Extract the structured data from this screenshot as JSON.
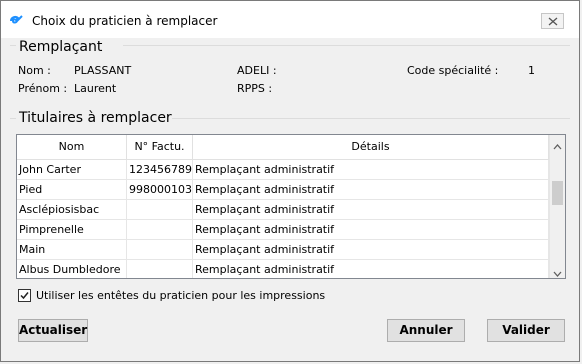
{
  "window": {
    "title": "Choix du praticien à remplacer"
  },
  "remplacant": {
    "group_title": "Remplaçant",
    "nom_label": "Nom :",
    "nom_value": "PLASSANT",
    "prenom_label": "Prénom :",
    "prenom_value": "Laurent",
    "adeli_label": "ADELI :",
    "adeli_value": "",
    "rpps_label": "RPPS :",
    "rpps_value": "",
    "code_label": "Code spécialité :",
    "code_value": "1"
  },
  "titulaires": {
    "group_title": "Titulaires à remplacer",
    "columns": [
      "Nom",
      "N° Factu.",
      "Détails"
    ],
    "rows": [
      {
        "nom": "John Carter",
        "factu": "123456789",
        "details": "Remplaçant administratif"
      },
      {
        "nom": "Pied",
        "factu": "998000103",
        "details": "Remplaçant administratif"
      },
      {
        "nom": "Asclépiosisbac",
        "factu": "",
        "details": "Remplaçant administratif"
      },
      {
        "nom": "Pimprenelle",
        "factu": "",
        "details": "Remplaçant administratif"
      },
      {
        "nom": "Main",
        "factu": "",
        "details": "Remplaçant administratif"
      },
      {
        "nom": "Albus Dumbledore",
        "factu": "",
        "details": "Remplaçant administratif"
      }
    ]
  },
  "options": {
    "use_headers_label": "Utiliser les entêtes du praticien pour les impressions",
    "use_headers_checked": true
  },
  "buttons": {
    "refresh": "Actualiser",
    "cancel": "Annuler",
    "ok": "Valider"
  },
  "icons": {
    "app": "app-logo-icon",
    "close": "close-icon",
    "check": "checkmark-icon"
  },
  "colors": {
    "accent": "#1e90ff",
    "grid_border": "#828790"
  }
}
